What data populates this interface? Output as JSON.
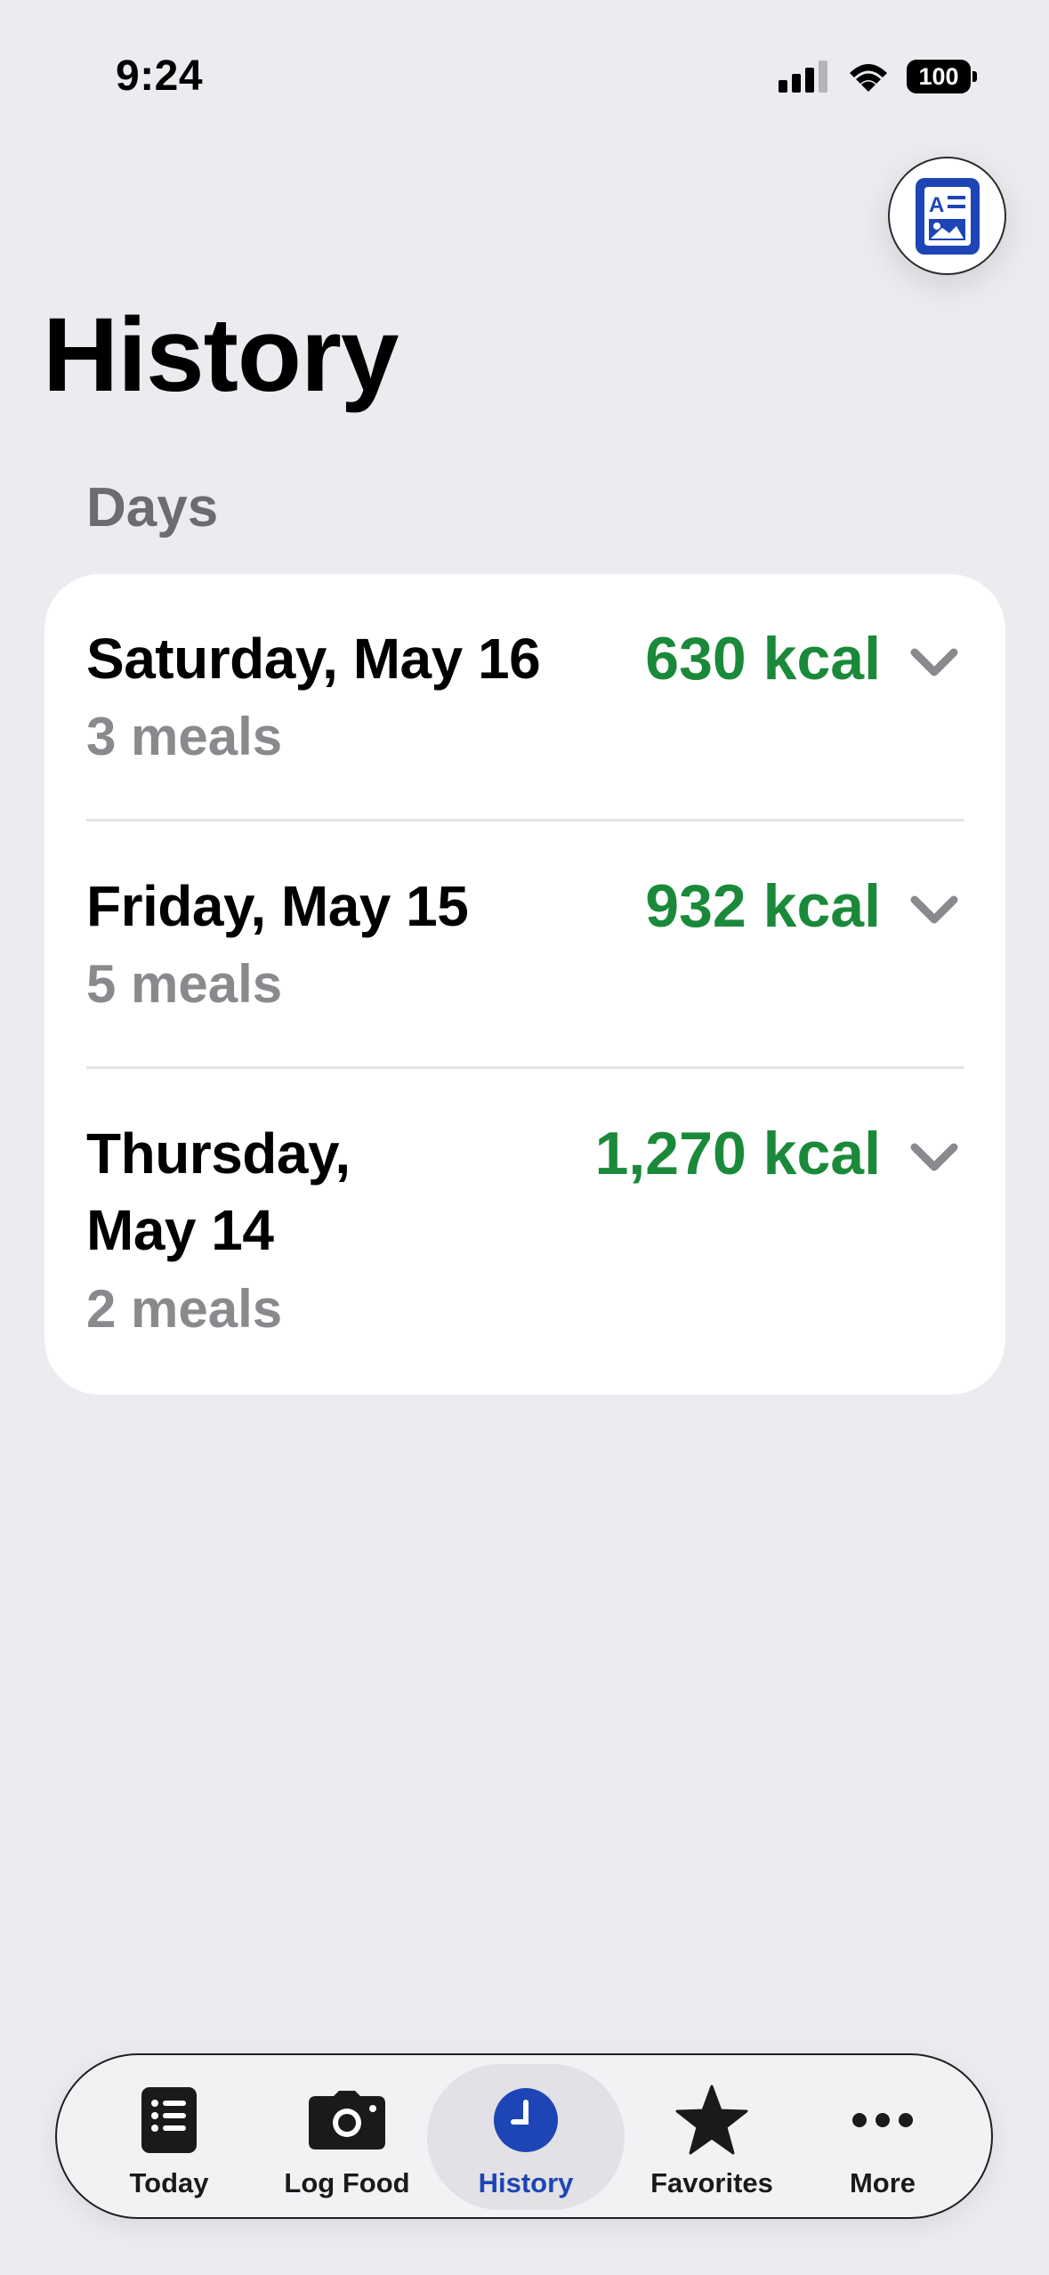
{
  "status_bar": {
    "time": "9:24",
    "battery": "100",
    "icons": [
      "cellular-signal-icon",
      "wifi-icon",
      "battery-icon"
    ]
  },
  "header": {
    "action_icon": "document-icon",
    "title": "History"
  },
  "section": {
    "label": "Days"
  },
  "days": [
    {
      "title": "Saturday, May 16",
      "meals": "3 meals",
      "kcal": "630 kcal"
    },
    {
      "title_line1": "Friday, May 15",
      "meals": "5 meals",
      "kcal": "932 kcal"
    },
    {
      "title_line1": "Thursday,",
      "title_line2": "May 14",
      "meals": "2 meals",
      "kcal": "1,270 kcal"
    }
  ],
  "tabs": [
    {
      "label": "Today",
      "icon": "list-icon"
    },
    {
      "label": "Log Food",
      "icon": "camera-icon"
    },
    {
      "label": "History",
      "icon": "clock-icon",
      "active": true
    },
    {
      "label": "Favorites",
      "icon": "star-icon"
    },
    {
      "label": "More",
      "icon": "more-icon"
    }
  ],
  "colors": {
    "accent": "#1d45b5",
    "kcal": "#1a8a3a",
    "background": "#ebebf0"
  }
}
